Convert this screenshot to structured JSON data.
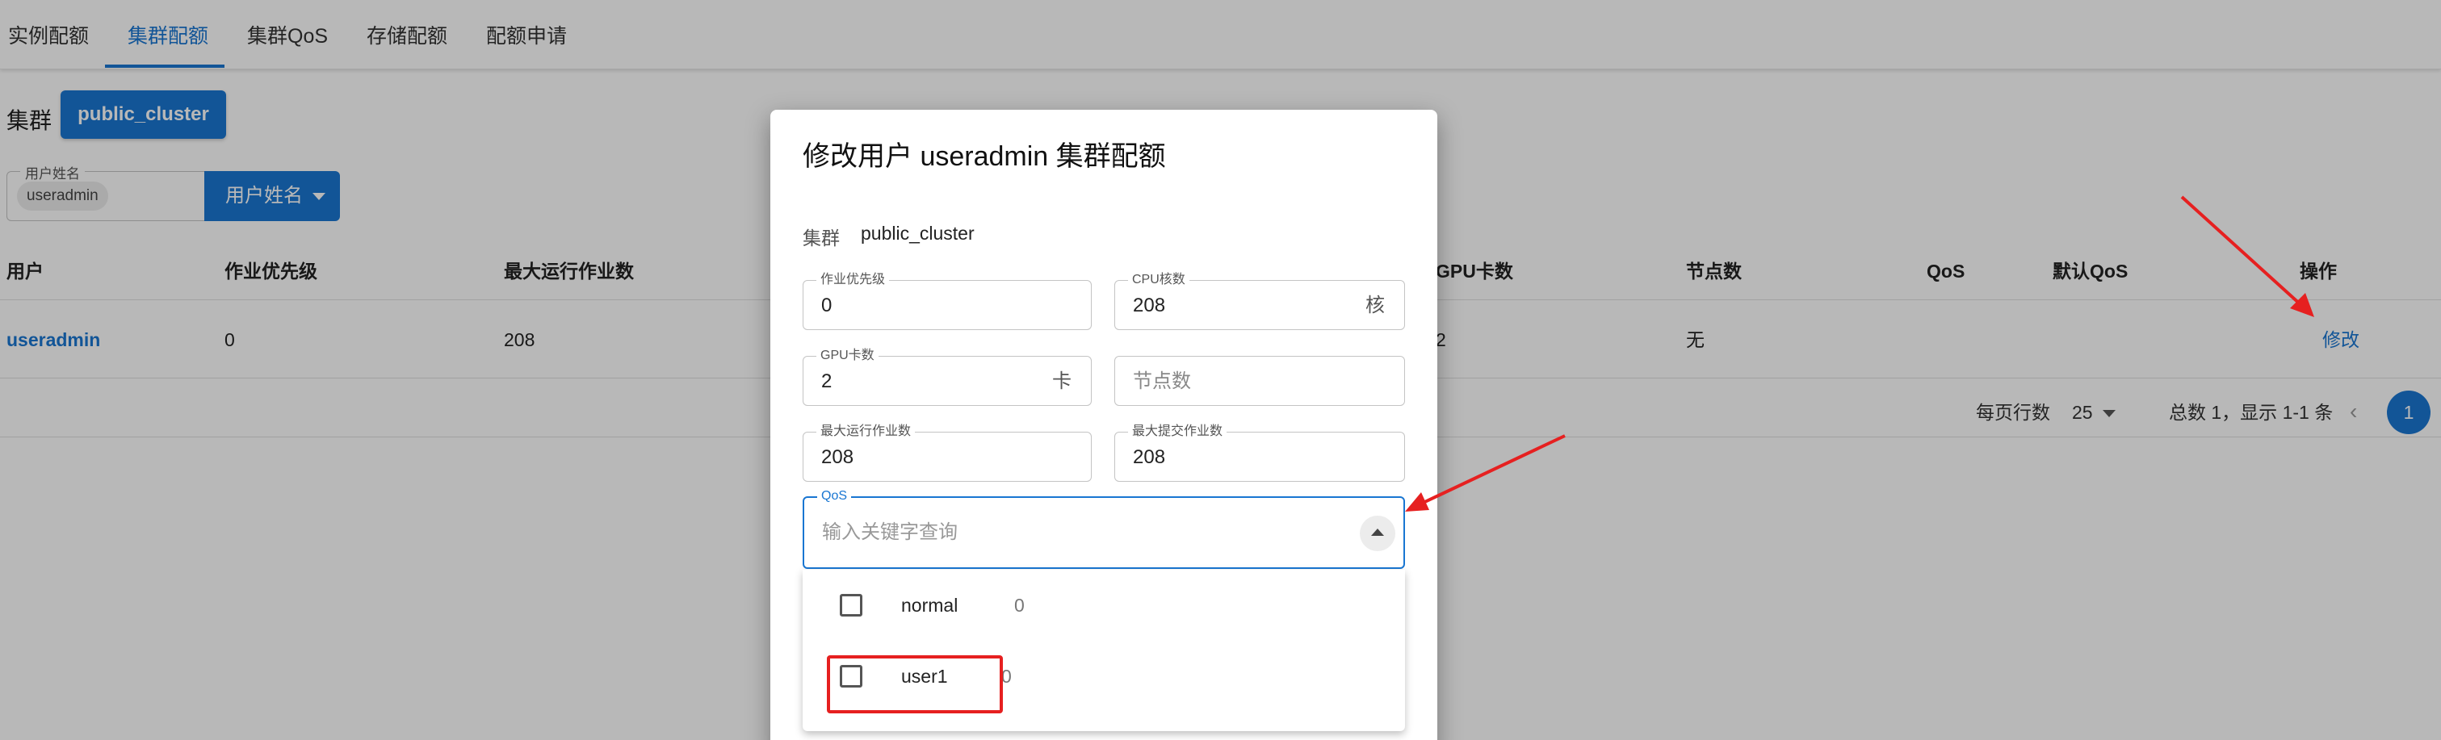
{
  "tabs": [
    {
      "label": "实例配额",
      "active": false
    },
    {
      "label": "集群配额",
      "active": true
    },
    {
      "label": "集群QoS",
      "active": false
    },
    {
      "label": "存储配额",
      "active": false
    },
    {
      "label": "配额申请",
      "active": false
    }
  ],
  "cluster_filter": {
    "label": "集群",
    "selected": "public_cluster"
  },
  "user_filter": {
    "legend": "用户姓名",
    "chip": "useradmin",
    "button_label": "用户姓名"
  },
  "table": {
    "headers": [
      "用户",
      "作业优先级",
      "最大运行作业数",
      "GPU卡数",
      "节点数",
      "QoS",
      "默认QoS",
      "操作"
    ],
    "row": {
      "user": "useradmin",
      "priority": "0",
      "max_running": "208",
      "gpu": "2",
      "nodes": "无",
      "qos": "",
      "default_qos": "",
      "action": "修改"
    }
  },
  "pagination": {
    "rows_per_page_label": "每页行数",
    "rows_per_page": "25",
    "summary": "总数 1，显示 1-1 条",
    "current_page": "1"
  },
  "dialog": {
    "title": "修改用户 useradmin 集群配额",
    "cluster_label": "集群",
    "cluster_value": "public_cluster",
    "fields": {
      "priority": {
        "label": "作业优先级",
        "value": "0"
      },
      "cpu": {
        "label": "CPU核数",
        "value": "208",
        "unit": "核"
      },
      "gpu": {
        "label": "GPU卡数",
        "value": "2",
        "unit": "卡"
      },
      "nodes": {
        "placeholder": "节点数"
      },
      "max_running": {
        "label": "最大运行作业数",
        "value": "208"
      },
      "max_submit": {
        "label": "最大提交作业数",
        "value": "208"
      }
    },
    "qos": {
      "label": "QoS",
      "placeholder": "输入关键字查询",
      "options": [
        {
          "name": "normal",
          "count": "0",
          "checked": false
        },
        {
          "name": "user1",
          "count": "0",
          "checked": false
        }
      ]
    }
  },
  "colors": {
    "accent": "#1976d2",
    "annotation": "#e62020"
  },
  "icons": {
    "dropdown": "caret-down-icon",
    "collapse": "caret-up-icon",
    "prev_page": "chevron-left-icon"
  }
}
